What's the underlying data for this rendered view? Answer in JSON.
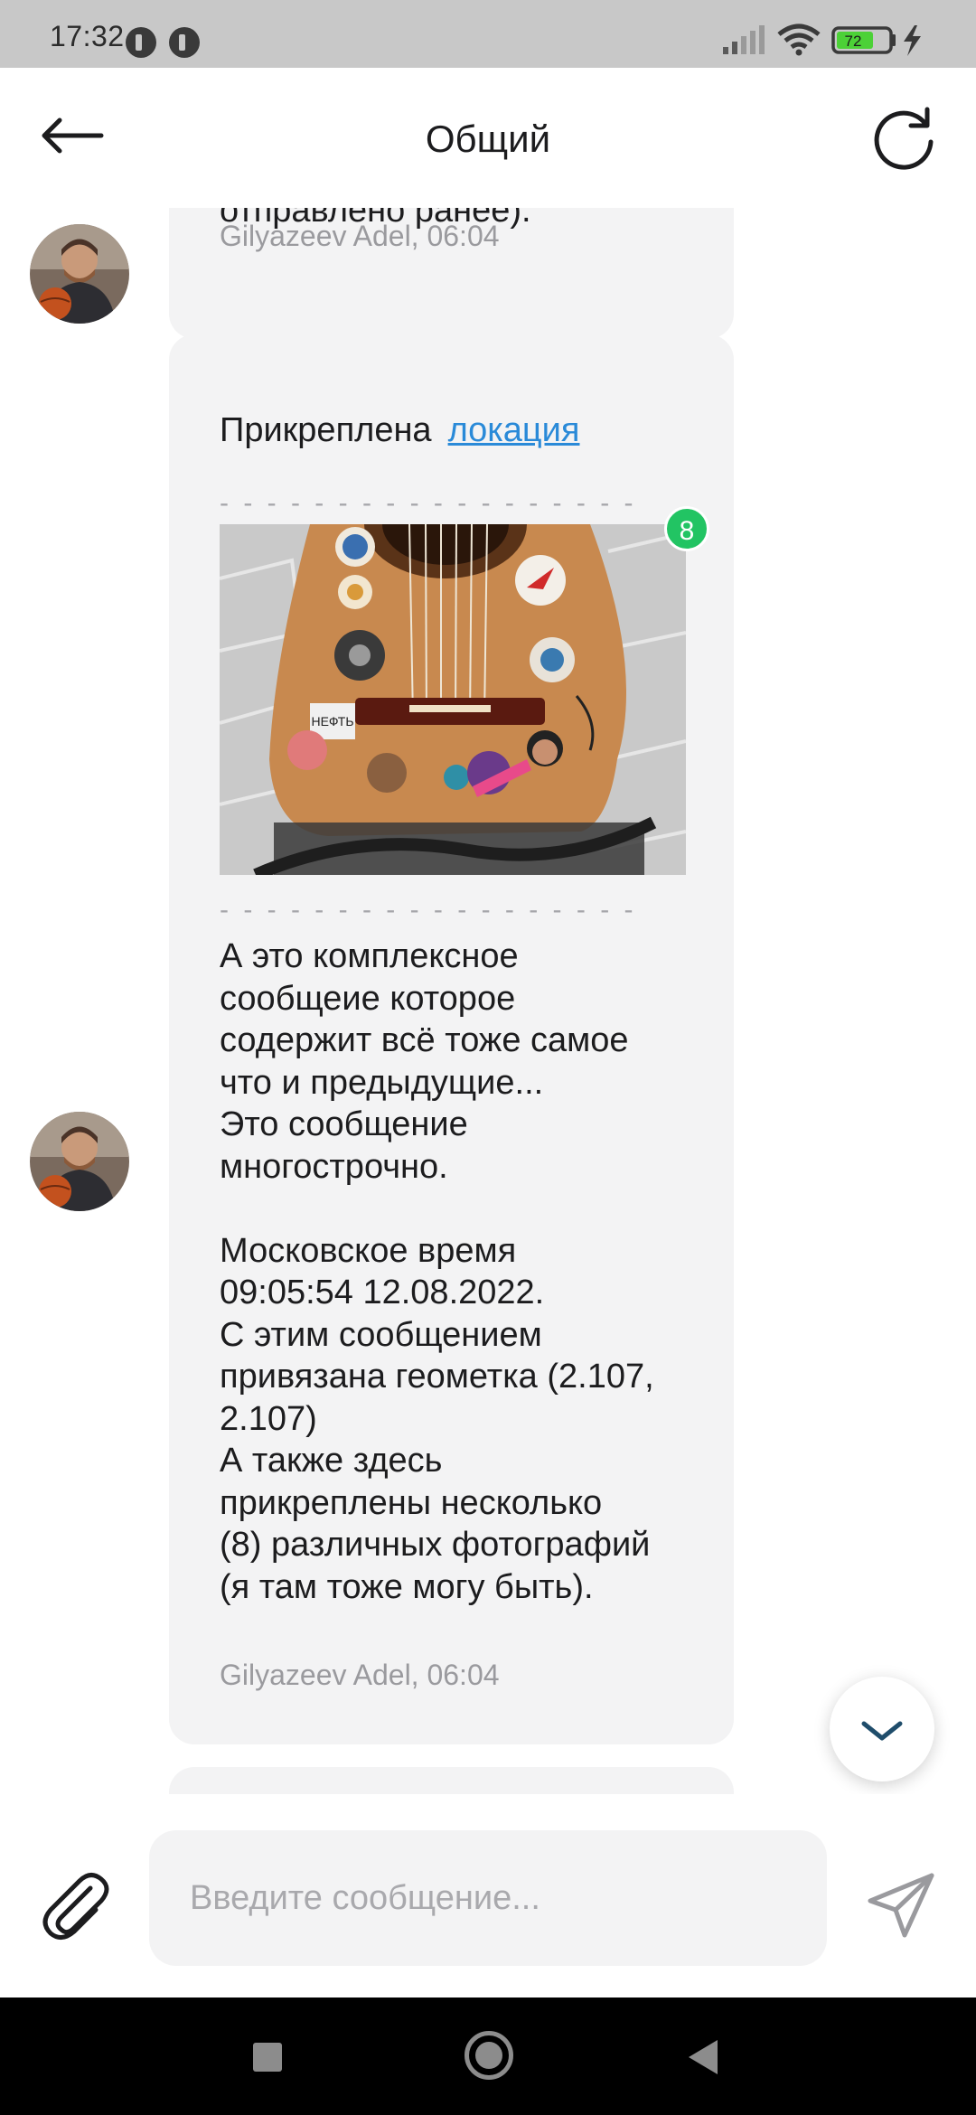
{
  "status_bar": {
    "time": "17:32",
    "battery": "72",
    "icons": [
      "signal-icon",
      "wifi-icon",
      "battery-icon",
      "charging-icon"
    ]
  },
  "app_bar": {
    "title": "Общий",
    "back_icon": "arrow-left-icon",
    "refresh_icon": "refresh-icon"
  },
  "messages": [
    {
      "partial_text": "отправлено ранее).",
      "author_time": "Gilyazeev Adel, 06:04"
    },
    {
      "location_prefix": "Прикреплена",
      "location_link": "локация",
      "divider": "- - - - - - - - - - - - - - - - - -",
      "photo_count": "8",
      "text": "А это комплексное\nсообщеие которое\nсодержит всё тоже самое\nчто и предыдущие...\nЭто сообщение\nмногострочно.\n\nМосковское время\n09:05:54 12.08.2022.\nС этим сообщением\nпривязана геометка (2.107,\n2.107)\nА также здесь\nприкреплены несколько\n(8) различных фотографий\n(я там тоже могу быть).",
      "author_time": "Gilyazeev Adel, 06:04"
    }
  ],
  "composer": {
    "placeholder": "Введите сообщение...",
    "attach_icon": "paperclip-icon",
    "send_icon": "send-icon"
  },
  "colors": {
    "accent_link": "#2a8ad8",
    "badge": "#22c463",
    "bubble_bg": "#f3f3f4",
    "status_bar_bg": "#c8c8c8"
  }
}
